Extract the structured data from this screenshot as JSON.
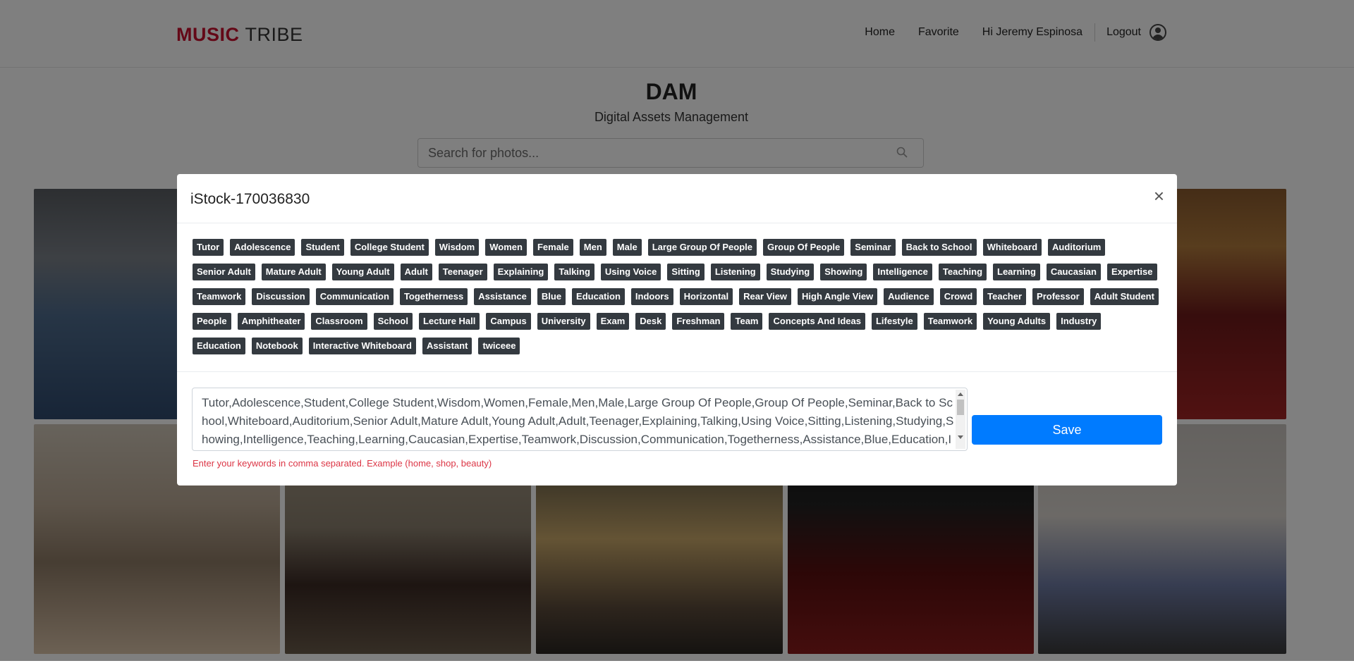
{
  "brand": {
    "logo_music": "MUSIC",
    "logo_tribe": "TRIBE"
  },
  "nav": {
    "home": "Home",
    "favorite": "Favorite",
    "greeting": "Hi Jeremy Espinosa",
    "logout": "Logout"
  },
  "hero": {
    "title": "DAM",
    "subtitle": "Digital Assets Management"
  },
  "search": {
    "placeholder": "Search for photos..."
  },
  "gallery": {
    "photos": [
      "lecture-hall",
      "theater",
      "classroom",
      "armchair",
      "ballroom",
      "stage",
      "speaker"
    ]
  },
  "modal": {
    "title": "iStock-170036830",
    "close_label": "×",
    "tags": [
      "Tutor",
      "Adolescence",
      "Student",
      "College Student",
      "Wisdom",
      "Women",
      "Female",
      "Men",
      "Male",
      "Large Group Of People",
      "Group Of People",
      "Seminar",
      "Back to School",
      "Whiteboard",
      "Auditorium",
      "Senior Adult",
      "Mature Adult",
      "Young Adult",
      "Adult",
      "Teenager",
      "Explaining",
      "Talking",
      "Using Voice",
      "Sitting",
      "Listening",
      "Studying",
      "Showing",
      "Intelligence",
      "Teaching",
      "Learning",
      "Caucasian",
      "Expertise",
      "Teamwork",
      "Discussion",
      "Communication",
      "Togetherness",
      "Assistance",
      "Blue",
      "Education",
      "Indoors",
      "Horizontal",
      "Rear View",
      "High Angle View",
      "Audience",
      "Crowd",
      "Teacher",
      "Professor",
      "Adult Student",
      "People",
      "Amphitheater",
      "Classroom",
      "School",
      "Lecture Hall",
      "Campus",
      "University",
      "Exam",
      "Desk",
      "Freshman",
      "Team",
      "Concepts And Ideas",
      "Lifestyle",
      "Teamwork",
      "Young Adults",
      "Industry",
      "Education",
      "Notebook",
      "Interactive Whiteboard",
      "Assistant",
      "twiceee"
    ],
    "keywords_value": "Tutor,Adolescence,Student,College Student,Wisdom,Women,Female,Men,Male,Large Group Of People,Group Of People,Seminar,Back to School,Whiteboard,Auditorium,Senior Adult,Mature Adult,Young Adult,Adult,Teenager,Explaining,Talking,Using Voice,Sitting,Listening,Studying,Showing,Intelligence,Teaching,Learning,Caucasian,Expertise,Teamwork,Discussion,Communication,Togetherness,Assistance,Blue,Education,Indoors,Horizontal,Rear View,High Angle View,Audience,Crowd,Teacher,Professor,Adult Student,People,Amphitheater,Classroom,School,Lecture Hall,Campus,University,Exam,Desk,Freshman,Team,Concepts And Ideas,Lifestyle,Teamwork,Young Adults,Industry,Education,Notebook,Interactive Whiteboard,Assistant,twiceee",
    "help_text": "Enter your keywords in comma separated. Example (home, shop, beauty)",
    "save_label": "Save"
  },
  "colors": {
    "accent": "#007bff",
    "tag_bg": "#343a40",
    "brand_red": "#c8102e",
    "help_text": "#dc3545"
  }
}
